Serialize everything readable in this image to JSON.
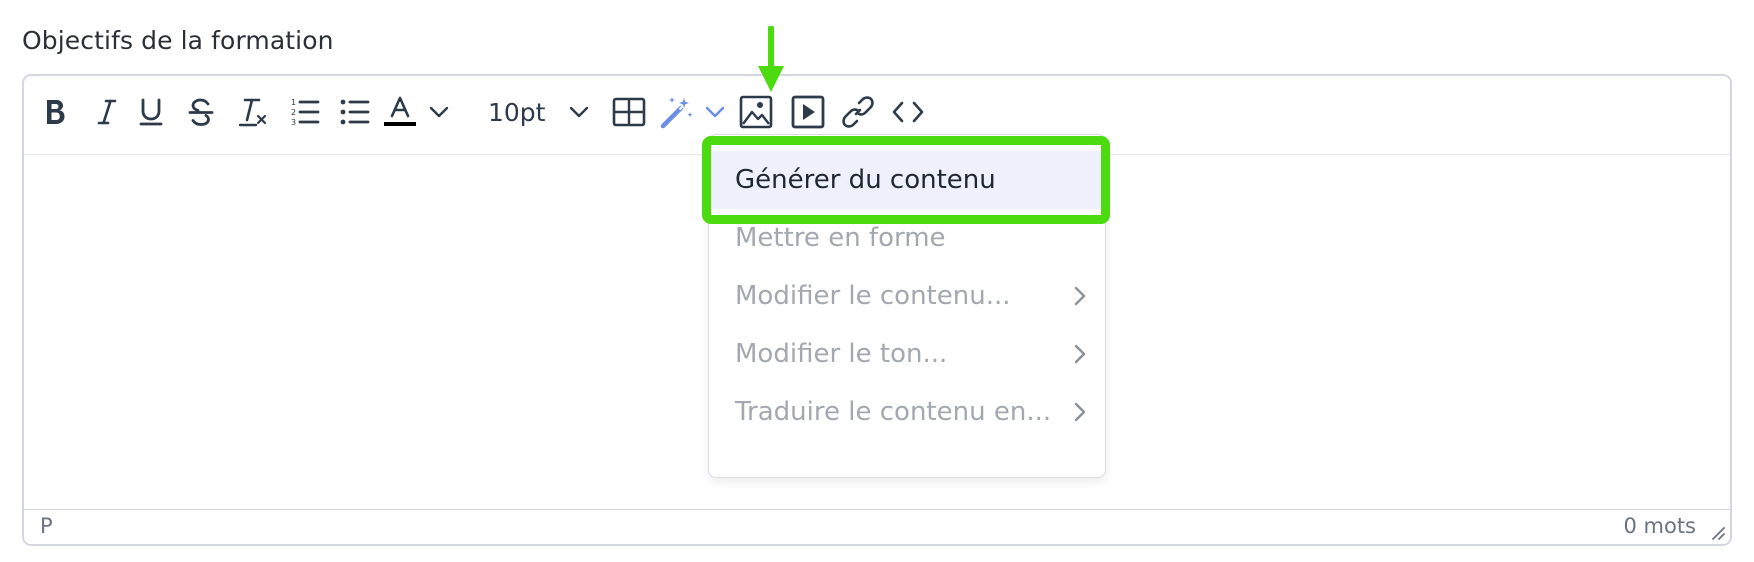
{
  "field": {
    "label": "Objectifs de la formation"
  },
  "toolbar": {
    "font_size": "10pt",
    "icons": [
      "bold-icon",
      "italic-icon",
      "underline-icon",
      "strikethrough-icon",
      "clear-format-icon",
      "ordered-list-icon",
      "bullet-list-icon",
      "text-color-icon",
      "chevron-down-icon",
      "table-icon",
      "magic-wand-icon",
      "image-icon",
      "media-icon",
      "link-icon",
      "code-icon"
    ]
  },
  "ai_menu": {
    "items": [
      {
        "label": "Générer du contenu",
        "active": true,
        "submenu": false
      },
      {
        "label": "Mettre en forme",
        "active": false,
        "submenu": false
      },
      {
        "label": "Modifier le contenu...",
        "active": false,
        "submenu": true
      },
      {
        "label": "Modifier le ton...",
        "active": false,
        "submenu": true
      },
      {
        "label": "Traduire le contenu en...",
        "active": false,
        "submenu": true
      }
    ]
  },
  "statusbar": {
    "path": "P",
    "word_count": "0 mots"
  },
  "colors": {
    "highlight": "#4cdb0f",
    "toolbar_icon": "#2d3a4a",
    "wand_accent": "#6a8de8",
    "menu_active_bg": "#eef1fb",
    "menu_disabled_text": "#a3a8b0"
  }
}
